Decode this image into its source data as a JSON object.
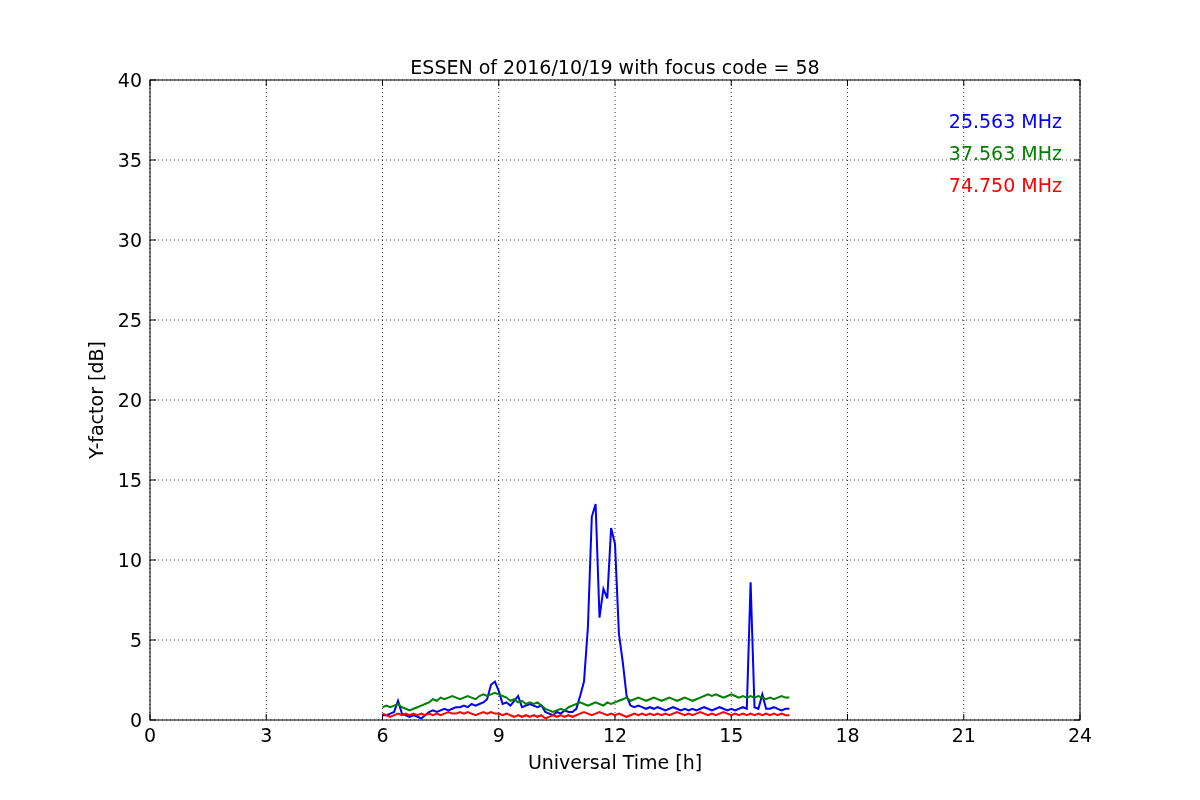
{
  "chart_data": {
    "type": "line",
    "title": "ESSEN of 2016/10/19 with focus code = 58",
    "xlabel": "Universal Time [h]",
    "ylabel": "Y-factor [dB]",
    "x": [
      6.0,
      6.1,
      6.2,
      6.3,
      6.4,
      6.5,
      6.6,
      6.7,
      6.8,
      6.9,
      7.0,
      7.1,
      7.2,
      7.3,
      7.4,
      7.5,
      7.6,
      7.7,
      7.8,
      7.9,
      8.0,
      8.1,
      8.2,
      8.3,
      8.4,
      8.5,
      8.6,
      8.7,
      8.8,
      8.9,
      9.0,
      9.1,
      9.2,
      9.3,
      9.4,
      9.5,
      9.6,
      9.7,
      9.8,
      9.9,
      10.0,
      10.1,
      10.2,
      10.3,
      10.4,
      10.5,
      10.6,
      10.7,
      10.8,
      10.9,
      11.0,
      11.1,
      11.2,
      11.3,
      11.4,
      11.5,
      11.6,
      11.7,
      11.8,
      11.9,
      12.0,
      12.1,
      12.2,
      12.3,
      12.4,
      12.5,
      12.6,
      12.7,
      12.8,
      12.9,
      13.0,
      13.1,
      13.2,
      13.3,
      13.4,
      13.5,
      13.6,
      13.7,
      13.8,
      13.9,
      14.0,
      14.1,
      14.2,
      14.3,
      14.4,
      14.5,
      14.6,
      14.7,
      14.8,
      14.9,
      15.0,
      15.1,
      15.2,
      15.3,
      15.4,
      15.5,
      15.6,
      15.7,
      15.8,
      15.9,
      16.0,
      16.1,
      16.2,
      16.3,
      16.4,
      16.5
    ],
    "series": [
      {
        "name": "25.563 MHz",
        "color": "#0000ff",
        "values": [
          0.3,
          0.3,
          0.4,
          0.5,
          1.2,
          0.4,
          0.3,
          0.2,
          0.3,
          0.2,
          0.1,
          0.3,
          0.5,
          0.6,
          0.5,
          0.6,
          0.7,
          0.6,
          0.7,
          0.8,
          0.8,
          0.9,
          0.8,
          1.0,
          0.9,
          1.0,
          1.1,
          1.3,
          2.2,
          2.4,
          1.8,
          1.0,
          1.1,
          0.9,
          1.2,
          1.5,
          0.8,
          0.9,
          1.0,
          0.9,
          0.8,
          0.9,
          0.5,
          0.4,
          0.3,
          0.5,
          0.4,
          0.6,
          0.5,
          0.5,
          0.7,
          1.5,
          2.4,
          5.8,
          12.7,
          13.5,
          6.4,
          8.2,
          7.6,
          12.0,
          11.0,
          5.4,
          3.6,
          1.5,
          0.9,
          0.8,
          0.9,
          0.8,
          0.7,
          0.8,
          0.7,
          0.8,
          0.7,
          0.6,
          0.7,
          0.8,
          0.7,
          0.6,
          0.7,
          0.6,
          0.7,
          0.6,
          0.7,
          0.8,
          0.7,
          0.6,
          0.7,
          0.8,
          0.7,
          0.6,
          0.7,
          0.6,
          0.7,
          0.8,
          0.7,
          8.6,
          0.8,
          0.7,
          1.6,
          0.7,
          0.7,
          0.8,
          0.7,
          0.6,
          0.7,
          0.7
        ]
      },
      {
        "name": "37.563 MHz",
        "color": "#008000",
        "values": [
          0.8,
          0.9,
          0.8,
          0.9,
          1.0,
          0.8,
          0.7,
          0.6,
          0.7,
          0.8,
          0.9,
          1.0,
          1.1,
          1.3,
          1.2,
          1.4,
          1.3,
          1.4,
          1.5,
          1.4,
          1.3,
          1.4,
          1.5,
          1.4,
          1.3,
          1.5,
          1.6,
          1.5,
          1.6,
          1.7,
          1.6,
          1.5,
          1.4,
          1.2,
          1.3,
          1.1,
          1.2,
          1.0,
          1.1,
          1.0,
          1.1,
          0.9,
          0.7,
          0.6,
          0.5,
          0.6,
          0.7,
          0.6,
          0.8,
          0.9,
          1.0,
          1.1,
          1.0,
          0.9,
          1.0,
          1.1,
          1.0,
          0.9,
          1.1,
          1.0,
          1.1,
          1.2,
          1.3,
          1.4,
          1.2,
          1.3,
          1.4,
          1.3,
          1.2,
          1.3,
          1.4,
          1.3,
          1.2,
          1.3,
          1.4,
          1.3,
          1.2,
          1.3,
          1.4,
          1.3,
          1.2,
          1.3,
          1.4,
          1.5,
          1.6,
          1.5,
          1.6,
          1.5,
          1.4,
          1.5,
          1.6,
          1.5,
          1.4,
          1.5,
          1.4,
          1.5,
          1.4,
          1.5,
          1.4,
          1.3,
          1.4,
          1.3,
          1.4,
          1.5,
          1.4,
          1.4
        ]
      },
      {
        "name": "74.750 MHz",
        "color": "#ff0000",
        "values": [
          0.4,
          0.3,
          0.2,
          0.3,
          0.4,
          0.3,
          0.4,
          0.3,
          0.4,
          0.3,
          0.4,
          0.3,
          0.4,
          0.3,
          0.4,
          0.3,
          0.4,
          0.5,
          0.4,
          0.4,
          0.5,
          0.4,
          0.5,
          0.4,
          0.3,
          0.4,
          0.5,
          0.4,
          0.5,
          0.4,
          0.4,
          0.3,
          0.4,
          0.3,
          0.2,
          0.3,
          0.2,
          0.3,
          0.2,
          0.3,
          0.2,
          0.3,
          0.1,
          0.2,
          0.3,
          0.2,
          0.3,
          0.2,
          0.3,
          0.2,
          0.3,
          0.4,
          0.5,
          0.4,
          0.3,
          0.4,
          0.5,
          0.4,
          0.3,
          0.4,
          0.3,
          0.4,
          0.3,
          0.2,
          0.3,
          0.4,
          0.3,
          0.4,
          0.3,
          0.4,
          0.3,
          0.4,
          0.3,
          0.4,
          0.3,
          0.4,
          0.5,
          0.4,
          0.3,
          0.4,
          0.3,
          0.4,
          0.5,
          0.4,
          0.3,
          0.4,
          0.3,
          0.4,
          0.5,
          0.4,
          0.3,
          0.4,
          0.3,
          0.4,
          0.3,
          0.4,
          0.3,
          0.4,
          0.3,
          0.4,
          0.3,
          0.4,
          0.3,
          0.4,
          0.3,
          0.3
        ]
      }
    ],
    "grid": true,
    "xlim": [
      0,
      24
    ],
    "ylim": [
      0,
      40
    ],
    "xticks": [
      0,
      3,
      6,
      9,
      12,
      15,
      18,
      21,
      24
    ],
    "yticks": [
      0,
      5,
      10,
      15,
      20,
      25,
      30,
      35,
      40
    ]
  }
}
